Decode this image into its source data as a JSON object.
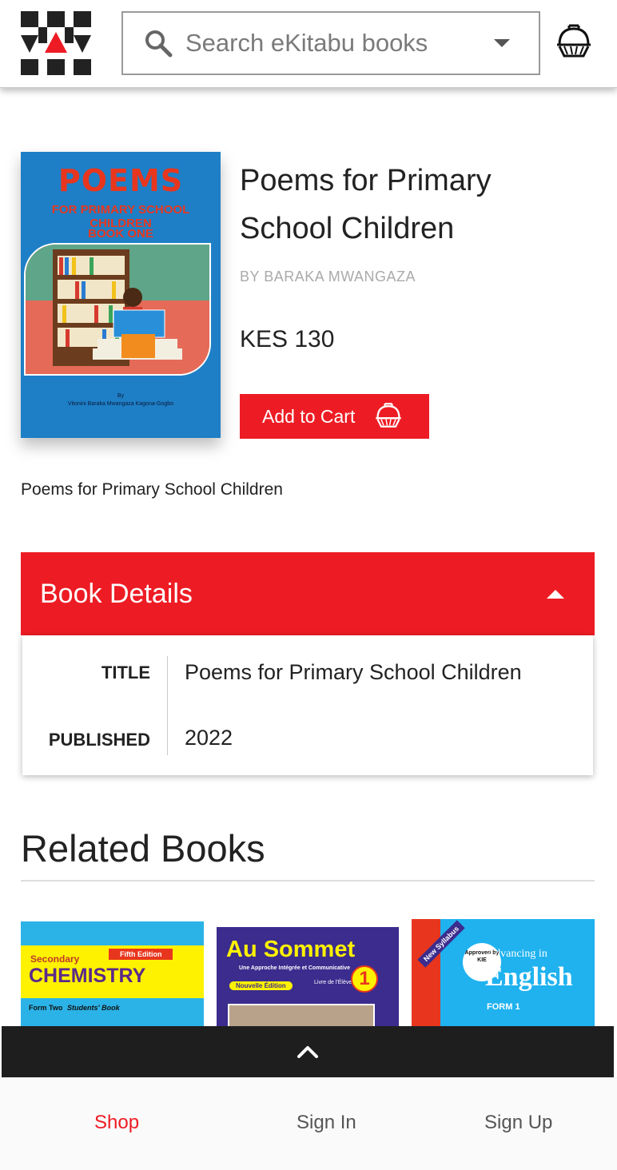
{
  "header": {
    "search_placeholder": "Search eKitabu books",
    "icons": {
      "logo": "ekitabu-logo",
      "search": "search-icon",
      "dropdown": "chevron-down-icon",
      "cart": "basket-icon"
    }
  },
  "product": {
    "title": "Poems for Primary School Children",
    "author": "BY BARAKA MWANGAZA",
    "price": "KES 130",
    "add_to_cart_label": "Add to Cart",
    "description": "Poems for Primary School Children",
    "cover": {
      "heading": "POEMS",
      "subheading": "FOR PRIMARY SCHOOL CHILDREN",
      "book_label": "BOOK ONE",
      "by": "By",
      "author_line": "Vitonini Baraka Mwangaza Kagona-Gogbo"
    }
  },
  "details": {
    "heading": "Book Details",
    "rows": [
      {
        "key": "TITLE",
        "value": "Poems for Primary School Children"
      },
      {
        "key": "PUBLISHED",
        "value": "2022"
      }
    ]
  },
  "related": {
    "heading": "Related Books",
    "books": [
      {
        "line1": "Secondary",
        "edition": "Fifth Edition",
        "title": "CHEMISTRY",
        "form": "Form Two",
        "sub": "Students' Book"
      },
      {
        "title": "Au Sommet",
        "sub": "Une Approche Intégrée et Communicative",
        "badge": "Nouvelle Édition",
        "level": "Livre de l'Élève",
        "num": "1"
      },
      {
        "tag": "New Syllabus",
        "approved": "Approved by KIE",
        "line1": "Advancing in",
        "title": "English",
        "form": "FORM 1"
      }
    ]
  },
  "bottom_nav": {
    "shop": "Shop",
    "sign_in": "Sign In",
    "sign_up": "Sign Up"
  },
  "colors": {
    "accent": "#ed1c24",
    "dark_bar": "#1e1e1e"
  }
}
